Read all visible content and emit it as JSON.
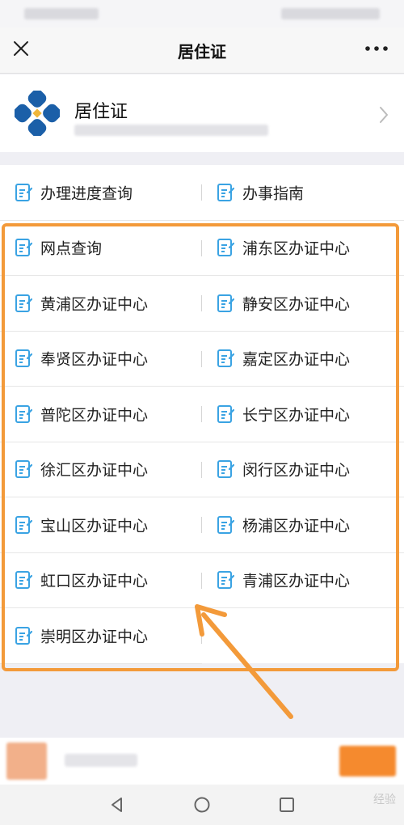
{
  "nav": {
    "title": "居住证"
  },
  "account": {
    "name": "居住证"
  },
  "menu_rows": [
    [
      "办理进度查询",
      "办事指南"
    ],
    [
      "网点查询",
      "浦东区办证中心"
    ],
    [
      "黄浦区办证中心",
      "静安区办证中心"
    ],
    [
      "奉贤区办证中心",
      "嘉定区办证中心"
    ],
    [
      "普陀区办证中心",
      "长宁区办证中心"
    ],
    [
      "徐汇区办证中心",
      "闵行区办证中心"
    ],
    [
      "宝山区办证中心",
      "杨浦区办证中心"
    ],
    [
      "虹口区办证中心",
      "青浦区办证中心"
    ],
    [
      "崇明区办证中心",
      ""
    ]
  ],
  "watermark": "经验",
  "colors": {
    "highlight": "#f39a3a",
    "icon_blue": "#3aa3e3",
    "logo_blue": "#1b5fa8",
    "logo_gold": "#f0b63a"
  },
  "icons": {
    "close": "close-icon",
    "more": "more-icon",
    "item": "document-edit-icon",
    "arrow": "chevron-right-icon"
  }
}
